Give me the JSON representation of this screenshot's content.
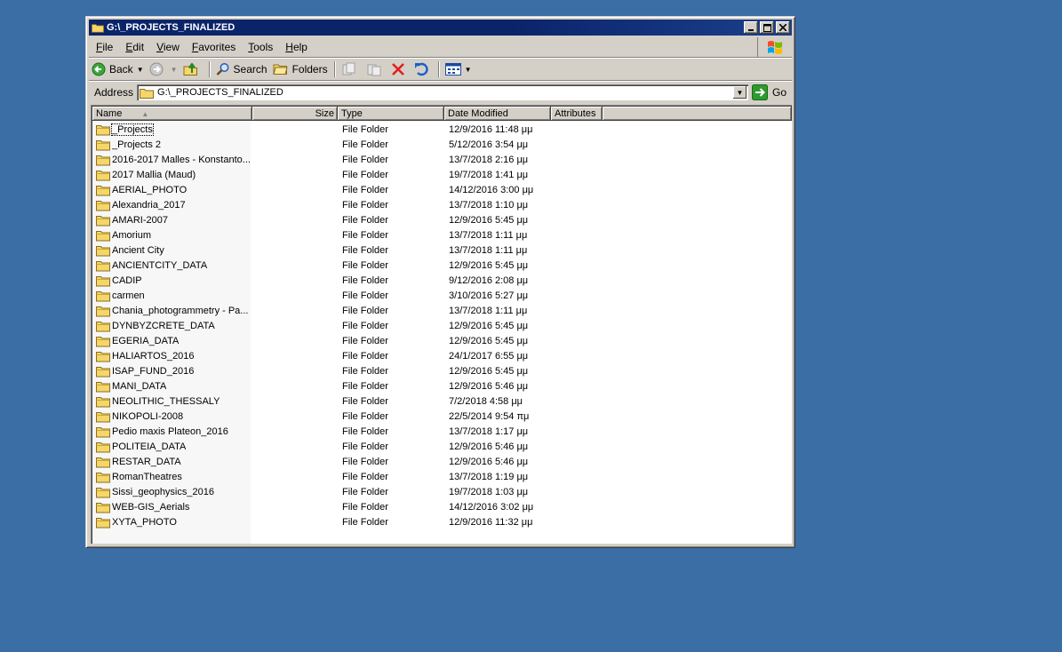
{
  "window": {
    "title": "G:\\_PROJECTS_FINALIZED"
  },
  "menu": [
    "File",
    "Edit",
    "View",
    "Favorites",
    "Tools",
    "Help"
  ],
  "toolbar": {
    "back": "Back",
    "search": "Search",
    "folders": "Folders"
  },
  "address": {
    "label": "Address",
    "value": "G:\\_PROJECTS_FINALIZED",
    "go": "Go"
  },
  "columns": {
    "name": "Name",
    "size": "Size",
    "type": "Type",
    "date": "Date Modified",
    "attributes": "Attributes"
  },
  "files": [
    {
      "name": "_Projects",
      "type": "File Folder",
      "date": "12/9/2016 11:48 μμ"
    },
    {
      "name": "_Projects 2",
      "type": "File Folder",
      "date": "5/12/2016 3:54 μμ"
    },
    {
      "name": "2016-2017 Malles - Konstanto...",
      "type": "File Folder",
      "date": "13/7/2018 2:16 μμ"
    },
    {
      "name": "2017 Mallia (Maud)",
      "type": "File Folder",
      "date": "19/7/2018 1:41 μμ"
    },
    {
      "name": "AERIAL_PHOTO",
      "type": "File Folder",
      "date": "14/12/2016 3:00 μμ"
    },
    {
      "name": "Alexandria_2017",
      "type": "File Folder",
      "date": "13/7/2018 1:10 μμ"
    },
    {
      "name": "AMARI-2007",
      "type": "File Folder",
      "date": "12/9/2016 5:45 μμ"
    },
    {
      "name": "Amorium",
      "type": "File Folder",
      "date": "13/7/2018 1:11 μμ"
    },
    {
      "name": "Ancient City",
      "type": "File Folder",
      "date": "13/7/2018 1:11 μμ"
    },
    {
      "name": "ANCIENTCITY_DATA",
      "type": "File Folder",
      "date": "12/9/2016 5:45 μμ"
    },
    {
      "name": "CADIP",
      "type": "File Folder",
      "date": "9/12/2016 2:08 μμ"
    },
    {
      "name": "carmen",
      "type": "File Folder",
      "date": "3/10/2016 5:27 μμ"
    },
    {
      "name": "Chania_photogrammetry - Pa...",
      "type": "File Folder",
      "date": "13/7/2018 1:11 μμ"
    },
    {
      "name": "DYNBYZCRETE_DATA",
      "type": "File Folder",
      "date": "12/9/2016 5:45 μμ"
    },
    {
      "name": "EGERIA_DATA",
      "type": "File Folder",
      "date": "12/9/2016 5:45 μμ"
    },
    {
      "name": "HALIARTOS_2016",
      "type": "File Folder",
      "date": "24/1/2017 6:55 μμ"
    },
    {
      "name": "ISAP_FUND_2016",
      "type": "File Folder",
      "date": "12/9/2016 5:45 μμ"
    },
    {
      "name": "MANI_DATA",
      "type": "File Folder",
      "date": "12/9/2016 5:46 μμ"
    },
    {
      "name": "NEOLITHIC_THESSALY",
      "type": "File Folder",
      "date": "7/2/2018 4:58 μμ"
    },
    {
      "name": "NIKOPOLI-2008",
      "type": "File Folder",
      "date": "22/5/2014 9:54 πμ"
    },
    {
      "name": "Pedio maxis Plateon_2016",
      "type": "File Folder",
      "date": "13/7/2018 1:17 μμ"
    },
    {
      "name": "POLITEIA_DATA",
      "type": "File Folder",
      "date": "12/9/2016 5:46 μμ"
    },
    {
      "name": "RESTAR_DATA",
      "type": "File Folder",
      "date": "12/9/2016 5:46 μμ"
    },
    {
      "name": "RomanTheatres",
      "type": "File Folder",
      "date": "13/7/2018 1:19 μμ"
    },
    {
      "name": "Sissi_geophysics_2016",
      "type": "File Folder",
      "date": "19/7/2018 1:03 μμ"
    },
    {
      "name": "WEB-GIS_Aerials",
      "type": "File Folder",
      "date": "14/12/2016 3:02 μμ"
    },
    {
      "name": "XYTA_PHOTO",
      "type": "File Folder",
      "date": "12/9/2016 11:32 μμ"
    }
  ],
  "icons": {
    "folder": "folder-icon",
    "back": "back-arrow-icon",
    "forward": "forward-arrow-icon",
    "up": "up-folder-icon",
    "search": "search-icon",
    "folders": "folders-icon",
    "move": "move-to-icon",
    "copy": "copy-to-icon",
    "delete": "delete-icon",
    "undo": "undo-icon",
    "views": "views-icon",
    "go": "go-arrow-icon"
  },
  "colors": {
    "desktop": "#3a6ea5",
    "titlebar": "#0a246a",
    "chrome": "#d4d0c8",
    "folder": "#f5d66b"
  }
}
